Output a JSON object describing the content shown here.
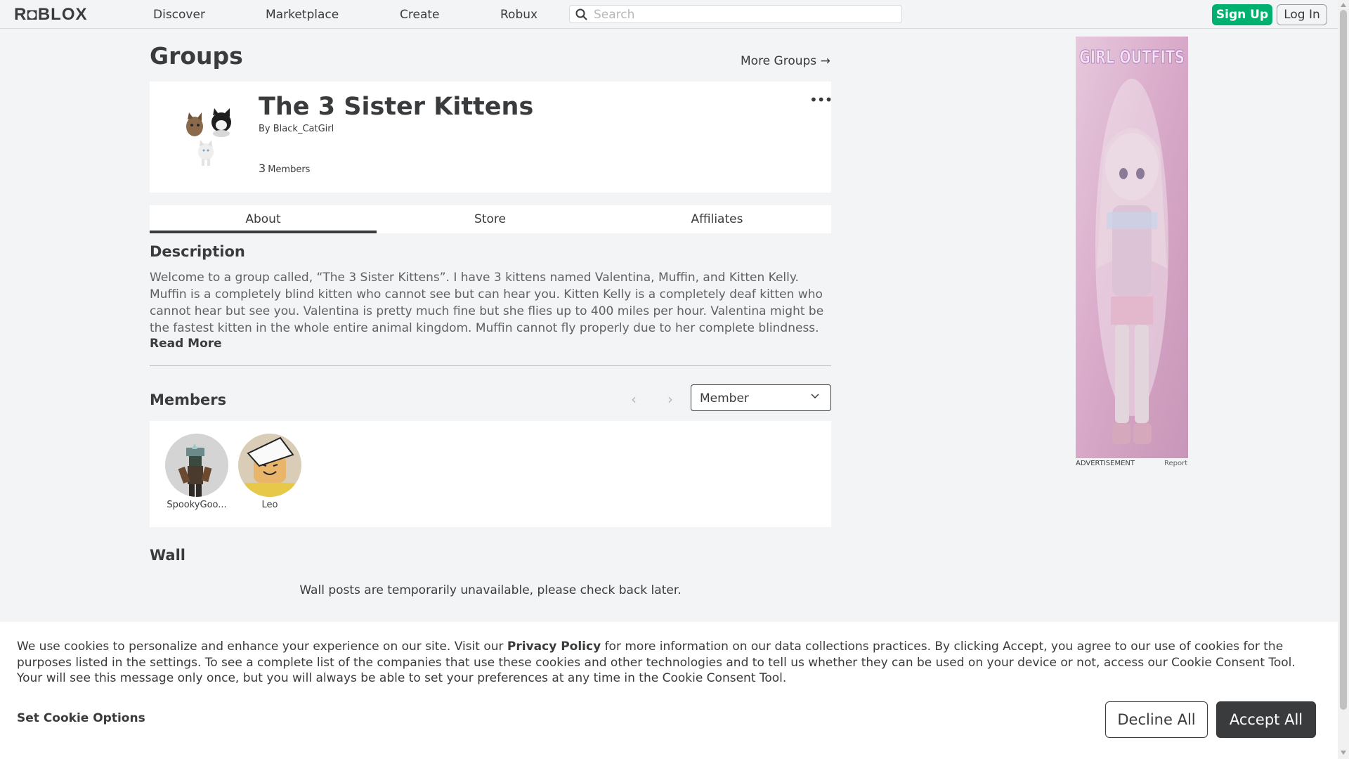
{
  "header": {
    "logo": "R◘BLOX",
    "nav": [
      "Discover",
      "Marketplace",
      "Create",
      "Robux"
    ],
    "search_placeholder": "Search",
    "signup_label": "Sign Up",
    "login_label": "Log In"
  },
  "page": {
    "title": "Groups",
    "more_groups": "More Groups →"
  },
  "group": {
    "name": "The 3 Sister Kittens",
    "by_prefix": "By",
    "owner": "Black_CatGirl",
    "member_count": "3",
    "member_label": "Members",
    "menu_glyph": "•••"
  },
  "tabs": [
    "About",
    "Store",
    "Affiliates"
  ],
  "description": {
    "heading": "Description",
    "text": "Welcome to a group called, “The 3 Sister Kittens”. I have 3 kittens named Valentina, Muffin, and Kitten Kelly. Muffin is a completely blind kitten who cannot see but can hear you. Kitten Kelly is a completely deaf kitten who cannot hear but see you. Valentina is pretty much fine but she flies up to 400 miles per hour. Valentina might be the fastest kitten in the whole entire animal kingdom. Muffin cannot fly properly due to her complete blindness. Kitten",
    "read_more": "Read More"
  },
  "members": {
    "heading": "Members",
    "role_selected": "Member",
    "list": [
      {
        "name": "SpookyGoo..."
      },
      {
        "name": "Leo"
      }
    ]
  },
  "wall": {
    "heading": "Wall",
    "message": "Wall posts are temporarily unavailable, please check back later."
  },
  "ad": {
    "image_text": "GIRL OUTFITS",
    "label": "ADVERTISEMENT",
    "report": "Report"
  },
  "cookie": {
    "text_before": "We use cookies to personalize and enhance your experience on our site. Visit our ",
    "link": "Privacy Policy",
    "text_after": " for more information on our data collections practices. By clicking Accept, you agree to our use of cookies for the purposes listed in the settings. To see a complete list of the companies that use these cookies and other technologies and to tell us whether they can be used on your device or not, access our Cookie Consent Tool. Your will see this message only once, but you will always be able to set your preferences at any time in the Cookie Consent Tool.",
    "set_options": "Set Cookie Options",
    "decline": "Decline All",
    "accept": "Accept All"
  },
  "colors": {
    "background": "#f2f4f5",
    "signup_green": "#00b06f",
    "text_dark": "#393b3d",
    "accept_bg": "#393b3d"
  }
}
